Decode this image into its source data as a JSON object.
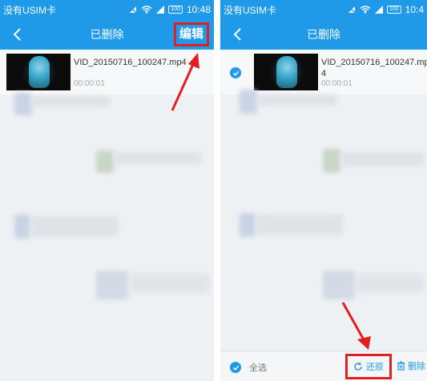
{
  "status": {
    "carrier": "没有USIM卡",
    "battery": "100",
    "time_left": "10:48",
    "time_right": "10:4"
  },
  "header": {
    "title": "已删除",
    "edit_label": "编辑"
  },
  "item": {
    "filename": "VID_20150716_100247.mp4",
    "filename_wrapped_line1": "VID_20150716_100247.mp",
    "filename_wrapped_line2": "4",
    "duration": "00:00:01"
  },
  "bottom_bar": {
    "select_all_label": "全选",
    "restore_label": "还原",
    "delete_label": "删除"
  },
  "colors": {
    "accent": "#1e9ae9",
    "highlight_box": "#e02020",
    "annotation_arrow": "#e02020",
    "background": "#eef1f4"
  }
}
